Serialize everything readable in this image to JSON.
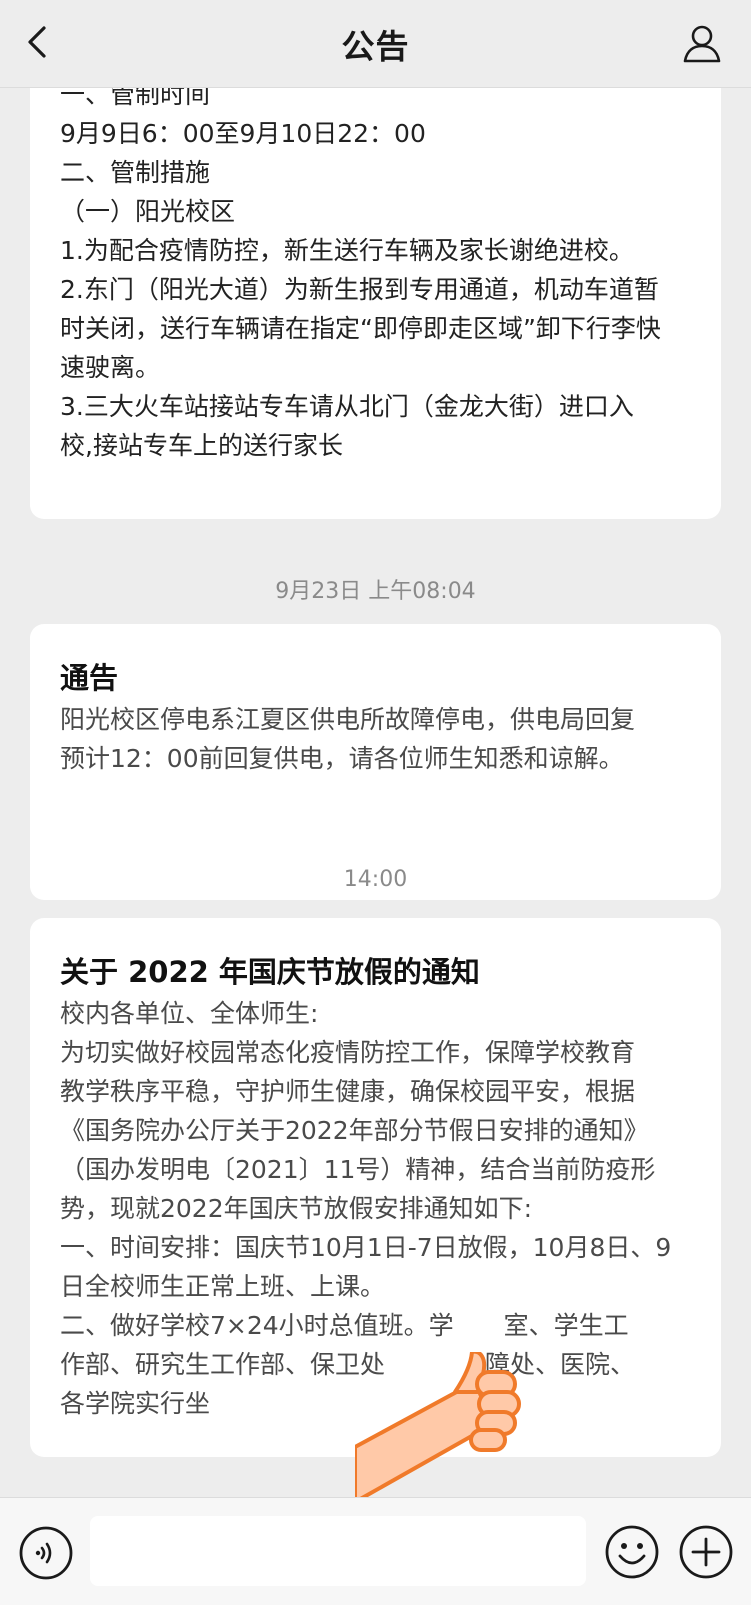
{
  "header": {
    "title": "公告"
  },
  "messages": [
    {
      "lines": [
        "一、管制时间",
        "9月9日6：00至9月10日22：00",
        "二、管制措施",
        "（一）阳光校区",
        "1.为配合疫情防控，新生送行车辆及家长谢绝进校。",
        "2.东门（阳光大道）为新生报到专用通道，机动车道暂",
        "时关闭，送行车辆请在指定“即停即走区域”卸下行李快",
        "速驶离。",
        "3.三大火车站接站专车请从北门（金龙大街）进口入",
        "校,接站专车上的送行家长"
      ]
    },
    {
      "timestamp": "9月23日 上午08:04",
      "title": "通告",
      "lines": [
        "阳光校区停电系江夏区供电所故障停电，供电局回复",
        "预计12：00前回复供电，请各位师生知悉和谅解。"
      ]
    },
    {
      "timestamp": "14:00",
      "title": "关于 2022 年国庆节放假的通知",
      "lines": [
        "校内各单位、全体师生:",
        "为切实做好校园常态化疫情防控工作，保障学校教育",
        "教学秩序平稳，守护师生健康，确保校园平安，根据",
        "《国务院办公厅关于2022年部分节假日安排的通知》",
        "（国办发明电〔2021〕11号）精神，结合当前防疫形",
        "势，现就2022年国庆节放假安排通知如下:",
        "一、时间安排：国庆节10月1日-7日放假，10月8日、9",
        "日全校师生正常上班、上课。",
        "二、做好学校7×24小时总值班。学　　室、学生工",
        "作部、研究生工作部、保卫处　　　　障处、医院、",
        "各学院实行坐"
      ]
    }
  ],
  "input": {
    "value": ""
  },
  "icons": {
    "back": "chevron-left-icon",
    "profile": "person-icon",
    "voice": "voice-icon",
    "emoji": "smiley-icon",
    "plus": "plus-icon",
    "thumb": "thumbs-up-icon"
  },
  "colors": {
    "background": "#ededed",
    "card": "#ffffff",
    "timestamp": "#8a8a8a",
    "thumb_fill": "#ffc9a8",
    "thumb_stroke": "#f07a2a"
  }
}
